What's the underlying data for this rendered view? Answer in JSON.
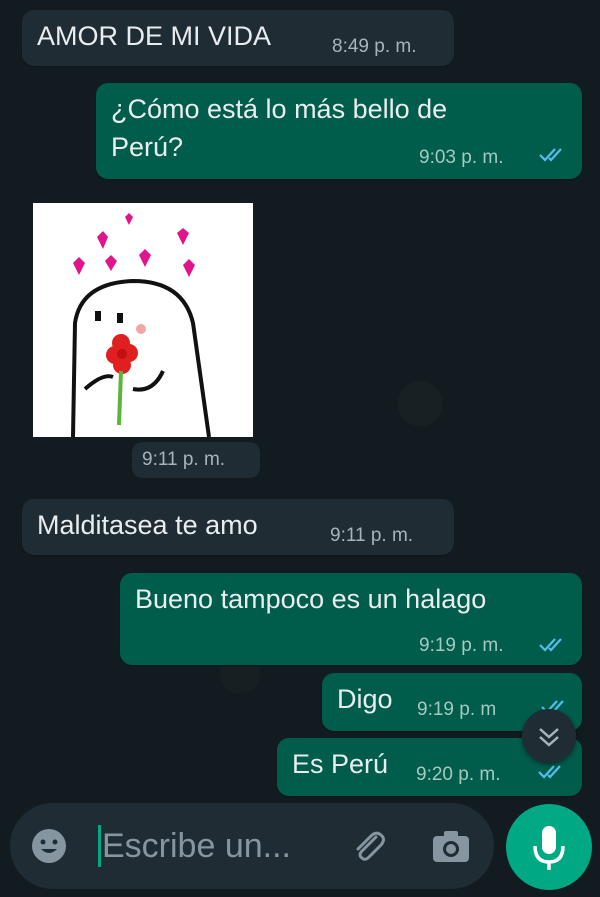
{
  "messages": [
    {
      "direction": "incoming",
      "text": "AMOR DE MI VIDA",
      "time": "8:49 p. m."
    },
    {
      "direction": "outgoing",
      "text_line1": "¿Cómo está lo más bello de",
      "text_line2": "Perú?",
      "time": "9:03 p. m.",
      "read": true
    },
    {
      "direction": "incoming",
      "type": "sticker",
      "time": "9:11 p. m."
    },
    {
      "direction": "incoming",
      "text": "Malditasea te amo",
      "time": "9:11 p. m."
    },
    {
      "direction": "outgoing",
      "text": "Bueno tampoco es un halago",
      "time": "9:19 p. m.",
      "read": true
    },
    {
      "direction": "outgoing",
      "text": "Digo",
      "time": "9:19 p. m",
      "read": true
    },
    {
      "direction": "outgoing",
      "text": "Es Perú",
      "time": "9:20 p. m.",
      "read": true
    }
  ],
  "composer": {
    "placeholder": "Escribe un...",
    "emoji_icon": "emoji-icon",
    "attach_icon": "paperclip-icon",
    "camera_icon": "camera-icon",
    "mic_icon": "microphone-icon"
  },
  "colors": {
    "incoming_bubble": "#1f2c33",
    "outgoing_bubble": "#005c4b",
    "accent": "#00a884",
    "read_ticks": "#53bdeb"
  }
}
